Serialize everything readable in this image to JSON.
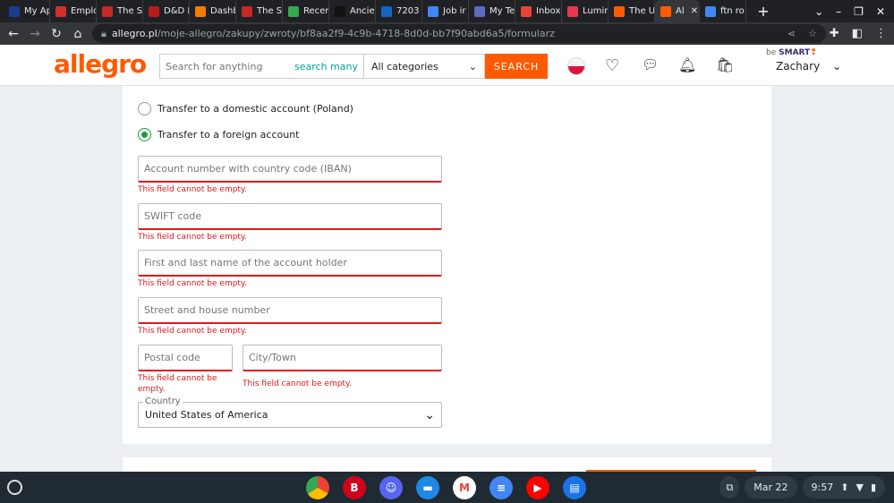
{
  "browser": {
    "tabs": [
      {
        "label": "My Ap",
        "color": "#1a3a8f"
      },
      {
        "label": "Emplo",
        "color": "#d32f2f"
      },
      {
        "label": "The S",
        "color": "#c62828"
      },
      {
        "label": "D&D B",
        "color": "#b71c1c"
      },
      {
        "label": "Dashb",
        "color": "#f57c00"
      },
      {
        "label": "The S",
        "color": "#c62828"
      },
      {
        "label": "Recen",
        "color": "#34a853"
      },
      {
        "label": "Ancie",
        "color": "#111111"
      },
      {
        "label": "7203",
        "color": "#1565c0"
      },
      {
        "label": "Job ir",
        "color": "#4285f4"
      },
      {
        "label": "My Te",
        "color": "#5c6bc0"
      },
      {
        "label": "Inbox",
        "color": "#ea4335"
      },
      {
        "label": "Lumir",
        "color": "#e53950"
      },
      {
        "label": "The U",
        "color": "#ff5a00"
      },
      {
        "label": "Al",
        "color": "#ff5a00",
        "active": true
      },
      {
        "label": "ftn ro",
        "color": "#4285f4"
      }
    ],
    "url_host": "allegro.pl",
    "url_path": "/moje-allegro/zakupy/zwroty/bf8aa2f9-4c9b-4718-8d0d-bb7f90abd6a5/formularz"
  },
  "header": {
    "logo": "allegro",
    "search_placeholder": "Search for anything",
    "search_many": "search many",
    "category": "All categories",
    "search_button": "SEARCH",
    "be": "be",
    "smart": "SMART",
    "user": "Zachary",
    "brand_color": "#ff5a00"
  },
  "form": {
    "radio_domestic": "Transfer to a domestic account (Poland)",
    "radio_foreign": "Transfer to a foreign account",
    "selected": "foreign",
    "iban_placeholder": "Account number with country code (IBAN)",
    "swift_placeholder": "SWIFT code",
    "name_placeholder": "First and last name of the account holder",
    "street_placeholder": "Street and house number",
    "postal_placeholder": "Postal code",
    "city_placeholder": "City/Town",
    "error": "This field cannot be empty.",
    "country_label": "Country",
    "country_value": "United States of America"
  },
  "taskbar": {
    "date": "Mar 22",
    "time": "9:57"
  }
}
